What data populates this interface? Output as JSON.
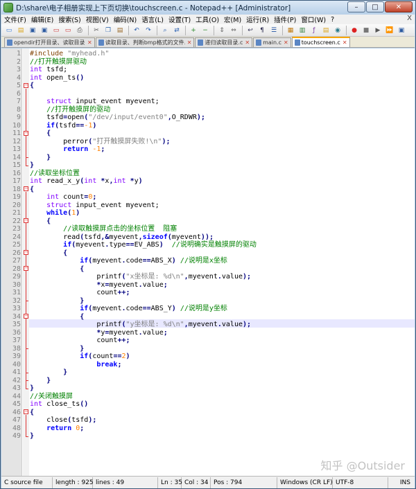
{
  "window": {
    "title": "D:\\share\\电子相册实现上下页切换\\touchscreen.c - Notepad++ [Administrator]",
    "minimize": "–",
    "maximize": "□",
    "close": "✕"
  },
  "menu": [
    "文件(F)",
    "编辑(E)",
    "搜索(S)",
    "视图(V)",
    "编码(N)",
    "语言(L)",
    "设置(T)",
    "工具(O)",
    "宏(M)",
    "运行(R)",
    "插件(P)",
    "窗口(W)",
    "?"
  ],
  "menu_close": "X",
  "toolbar_icons": [
    "new-file-icon",
    "open-file-icon",
    "save-icon",
    "save-all-icon",
    "close-file-icon",
    "close-all-icon",
    "print-icon",
    "|",
    "cut-icon",
    "copy-icon",
    "paste-icon",
    "|",
    "undo-icon",
    "redo-icon",
    "|",
    "find-icon",
    "replace-icon",
    "|",
    "zoom-in-icon",
    "zoom-out-icon",
    "|",
    "sync-vertical-icon",
    "sync-horizontal-icon",
    "|",
    "word-wrap-icon",
    "show-all-chars-icon",
    "indent-guide-icon",
    "|",
    "user-define-icon",
    "doc-map-icon",
    "function-list-icon",
    "folder-workspace-icon",
    "monitor-icon",
    "|",
    "record-macro-icon",
    "stop-record-icon",
    "play-macro-icon",
    "run-macro-multiple-icon",
    "save-macro-icon"
  ],
  "tabs": [
    {
      "label": "opendir打开目录、读取目录.c"
    },
    {
      "label": "读取目录、判断bmp格式的文件.c"
    },
    {
      "label": "递归读取目录.c"
    },
    {
      "label": "main.c"
    },
    {
      "label": "touchscreen.c",
      "active": true
    }
  ],
  "code_lines": [
    [
      [
        "p",
        "#include "
      ],
      [
        "s",
        "\"myhead.h\""
      ]
    ],
    [
      [
        "c",
        "//打开触摸屏驱动"
      ]
    ],
    [
      [
        "t",
        "int"
      ],
      [
        "x",
        " tsfd;"
      ]
    ],
    [
      [
        "t",
        "int"
      ],
      [
        "x",
        " open_ts"
      ],
      [
        "o",
        "()"
      ]
    ],
    [
      [
        "o",
        "{"
      ]
    ],
    [],
    [
      [
        "x",
        "    "
      ],
      [
        "t",
        "struct"
      ],
      [
        "x",
        " input_event myevent;"
      ]
    ],
    [
      [
        "x",
        "    "
      ],
      [
        "c",
        "//打开触摸屏的驱动"
      ]
    ],
    [
      [
        "x",
        "    tsfd"
      ],
      [
        "o",
        "="
      ],
      [
        "x",
        "open"
      ],
      [
        "o",
        "("
      ],
      [
        "s",
        "\"/dev/input/event0\""
      ],
      [
        "o",
        ","
      ],
      [
        "x",
        "O_RDWR"
      ],
      [
        "o",
        ");"
      ]
    ],
    [
      [
        "x",
        "    "
      ],
      [
        "k",
        "if"
      ],
      [
        "o",
        "("
      ],
      [
        "x",
        "tsfd"
      ],
      [
        "o",
        "=="
      ],
      [
        "n",
        "-1"
      ],
      [
        "o",
        ")"
      ]
    ],
    [
      [
        "x",
        "    "
      ],
      [
        "o",
        "{"
      ]
    ],
    [
      [
        "x",
        "        perror"
      ],
      [
        "o",
        "("
      ],
      [
        "s",
        "\"打开触摸屏失败!\\n\""
      ],
      [
        "o",
        ");"
      ]
    ],
    [
      [
        "x",
        "        "
      ],
      [
        "k",
        "return"
      ],
      [
        "x",
        " "
      ],
      [
        "n",
        "-1"
      ],
      [
        "o",
        ";"
      ]
    ],
    [
      [
        "x",
        "    "
      ],
      [
        "o",
        "}"
      ]
    ],
    [
      [
        "o",
        "}"
      ]
    ],
    [
      [
        "c",
        "//读取坐标位置"
      ]
    ],
    [
      [
        "t",
        "int"
      ],
      [
        "x",
        " read_x_y"
      ],
      [
        "o",
        "("
      ],
      [
        "t",
        "int"
      ],
      [
        "x",
        " "
      ],
      [
        "o",
        "*"
      ],
      [
        "x",
        "x"
      ],
      [
        "o",
        ","
      ],
      [
        "t",
        "int"
      ],
      [
        "x",
        " "
      ],
      [
        "o",
        "*"
      ],
      [
        "x",
        "y"
      ],
      [
        "o",
        ")"
      ]
    ],
    [
      [
        "o",
        "{"
      ]
    ],
    [
      [
        "x",
        "    "
      ],
      [
        "t",
        "int"
      ],
      [
        "x",
        " count"
      ],
      [
        "o",
        "="
      ],
      [
        "n",
        "0"
      ],
      [
        "o",
        ";"
      ]
    ],
    [
      [
        "x",
        "    "
      ],
      [
        "t",
        "struct"
      ],
      [
        "x",
        " input_event myevent;"
      ]
    ],
    [
      [
        "x",
        "    "
      ],
      [
        "k",
        "while"
      ],
      [
        "o",
        "("
      ],
      [
        "n",
        "1"
      ],
      [
        "o",
        ")"
      ]
    ],
    [
      [
        "x",
        "    "
      ],
      [
        "o",
        "{"
      ]
    ],
    [
      [
        "x",
        "        "
      ],
      [
        "c",
        "//读取触摸屏点击的坐标位置  阻塞"
      ]
    ],
    [
      [
        "x",
        "        read"
      ],
      [
        "o",
        "("
      ],
      [
        "x",
        "tsfd"
      ],
      [
        "o",
        ",&"
      ],
      [
        "x",
        "myevent"
      ],
      [
        "o",
        ","
      ],
      [
        "k",
        "sizeof"
      ],
      [
        "o",
        "("
      ],
      [
        "x",
        "myevent"
      ],
      [
        "o",
        "));"
      ]
    ],
    [
      [
        "x",
        "        "
      ],
      [
        "k",
        "if"
      ],
      [
        "o",
        "("
      ],
      [
        "x",
        "myevent"
      ],
      [
        "o",
        "."
      ],
      [
        "x",
        "type"
      ],
      [
        "o",
        "=="
      ],
      [
        "x",
        "EV_ABS"
      ],
      [
        "o",
        ")"
      ],
      [
        "x",
        "  "
      ],
      [
        "c",
        "//说明确实是触摸屏的驱动"
      ]
    ],
    [
      [
        "x",
        "        "
      ],
      [
        "o",
        "{"
      ]
    ],
    [
      [
        "x",
        "            "
      ],
      [
        "k",
        "if"
      ],
      [
        "o",
        "("
      ],
      [
        "x",
        "myevent"
      ],
      [
        "o",
        "."
      ],
      [
        "x",
        "code"
      ],
      [
        "o",
        "=="
      ],
      [
        "x",
        "ABS_X"
      ],
      [
        "o",
        ")"
      ],
      [
        "x",
        " "
      ],
      [
        "c",
        "//说明是x坐标"
      ]
    ],
    [
      [
        "x",
        "            "
      ],
      [
        "o",
        "{"
      ]
    ],
    [
      [
        "x",
        "                printf"
      ],
      [
        "o",
        "("
      ],
      [
        "s",
        "\"x坐标是: %d\\n\""
      ],
      [
        "o",
        ","
      ],
      [
        "x",
        "myevent"
      ],
      [
        "o",
        "."
      ],
      [
        "x",
        "value"
      ],
      [
        "o",
        ");"
      ]
    ],
    [
      [
        "x",
        "                "
      ],
      [
        "o",
        "*"
      ],
      [
        "x",
        "x"
      ],
      [
        "o",
        "="
      ],
      [
        "x",
        "myevent"
      ],
      [
        "o",
        "."
      ],
      [
        "x",
        "value"
      ],
      [
        "o",
        ";"
      ]
    ],
    [
      [
        "x",
        "                count"
      ],
      [
        "o",
        "++;"
      ]
    ],
    [
      [
        "x",
        "            "
      ],
      [
        "o",
        "}"
      ]
    ],
    [
      [
        "x",
        "            "
      ],
      [
        "k",
        "if"
      ],
      [
        "o",
        "("
      ],
      [
        "x",
        "myevent"
      ],
      [
        "o",
        "."
      ],
      [
        "x",
        "code"
      ],
      [
        "o",
        "=="
      ],
      [
        "x",
        "ABS_Y"
      ],
      [
        "o",
        ")"
      ],
      [
        "x",
        " "
      ],
      [
        "c",
        "//说明是y坐标"
      ]
    ],
    [
      [
        "x",
        "            "
      ],
      [
        "o",
        "{"
      ]
    ],
    [
      [
        "x",
        "                printf"
      ],
      [
        "o",
        "("
      ],
      [
        "s",
        "\"y坐标是: %d\\n\""
      ],
      [
        "o",
        ","
      ],
      [
        "x",
        "myevent"
      ],
      [
        "o",
        "."
      ],
      [
        "x",
        "value"
      ],
      [
        "o",
        ");"
      ]
    ],
    [
      [
        "x",
        "                "
      ],
      [
        "o",
        "*"
      ],
      [
        "x",
        "y"
      ],
      [
        "o",
        "="
      ],
      [
        "x",
        "myevent"
      ],
      [
        "o",
        "."
      ],
      [
        "x",
        "value"
      ],
      [
        "o",
        ";"
      ]
    ],
    [
      [
        "x",
        "                count"
      ],
      [
        "o",
        "++;"
      ]
    ],
    [
      [
        "x",
        "            "
      ],
      [
        "o",
        "}"
      ]
    ],
    [
      [
        "x",
        "            "
      ],
      [
        "k",
        "if"
      ],
      [
        "o",
        "("
      ],
      [
        "x",
        "count"
      ],
      [
        "o",
        "=="
      ],
      [
        "n",
        "2"
      ],
      [
        "o",
        ")"
      ]
    ],
    [
      [
        "x",
        "                "
      ],
      [
        "k",
        "break"
      ],
      [
        "o",
        ";"
      ]
    ],
    [
      [
        "x",
        "        "
      ],
      [
        "o",
        "}"
      ]
    ],
    [
      [
        "x",
        "    "
      ],
      [
        "o",
        "}"
      ]
    ],
    [
      [
        "o",
        "}"
      ]
    ],
    [
      [
        "c",
        "//关闭触摸屏"
      ]
    ],
    [
      [
        "t",
        "int"
      ],
      [
        "x",
        " close_ts"
      ],
      [
        "o",
        "()"
      ]
    ],
    [
      [
        "o",
        "{"
      ]
    ],
    [
      [
        "x",
        "    close"
      ],
      [
        "o",
        "("
      ],
      [
        "x",
        "tsfd"
      ],
      [
        "o",
        ");"
      ]
    ],
    [
      [
        "x",
        "    "
      ],
      [
        "k",
        "return"
      ],
      [
        "x",
        " "
      ],
      [
        "n",
        "0"
      ],
      [
        "o",
        ";"
      ]
    ],
    [
      [
        "o",
        "}"
      ]
    ]
  ],
  "watermark": "知乎 @Outsider",
  "status": {
    "lang": "C source file",
    "length": "length : 925",
    "lines": "lines : 49",
    "ln": "Ln : 35",
    "col": "Col : 34",
    "pos": "Pos : 794",
    "eol": "Windows (CR LF)",
    "encoding": "UTF-8",
    "mode": "INS"
  }
}
